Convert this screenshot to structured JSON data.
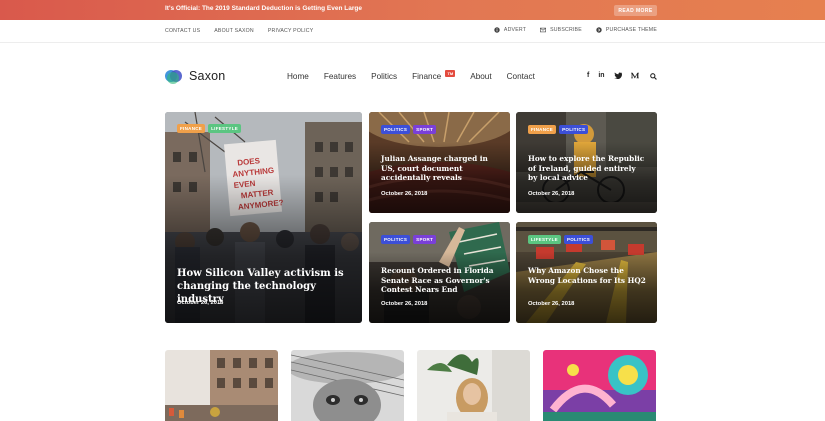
{
  "promo": {
    "text": "It's Official: The 2019 Standard Deduction is Getting Even Large",
    "button": "READ MORE"
  },
  "utility": {
    "links": [
      "CONTACT US",
      "ABOUT SAXON",
      "PRIVACY POLICY"
    ],
    "right": [
      {
        "label": "ADVERT",
        "icon": "info-icon"
      },
      {
        "label": "SUBSCRIBE",
        "icon": "mail-icon"
      },
      {
        "label": "PURCHASE THEME",
        "icon": "circle-arrow-icon"
      }
    ]
  },
  "header": {
    "logo": "Saxon",
    "nav": [
      "Home",
      "Features",
      "Politics",
      "Finance",
      "About",
      "Contact"
    ],
    "finance_badge": "TM",
    "social": [
      "f",
      "in",
      "twitter-icon",
      "medium-icon"
    ]
  },
  "colors": {
    "finance_tag": "#f0a04a",
    "lifestyle_tag": "#5bc581",
    "politics_tag": "#3c4fd8",
    "sport_tag": "#7a3fd8"
  },
  "cards": {
    "featured": {
      "tags": [
        "FINANCE",
        "LIFESTYLE"
      ],
      "title": "How Silicon Valley activism is changing the technology industry",
      "date": "October 26, 2018"
    },
    "top_middle": {
      "tags": [
        "POLITICS",
        "SPORT"
      ],
      "title": "Julian Assange charged in US, court document accidentally reveals",
      "date": "October 26, 2018"
    },
    "top_right": {
      "tags": [
        "FINANCE",
        "POLITICS"
      ],
      "title": "How to explore the Republic of Ireland, guided entirely by local advice",
      "date": "October 26, 2018"
    },
    "bottom_middle": {
      "tags": [
        "POLITICS",
        "SPORT"
      ],
      "title": "Recount Ordered in Florida Senate Race as Governor's Contest Nears End",
      "date": "October 26, 2018"
    },
    "bottom_right": {
      "tags": [
        "LIFESTYLE",
        "POLITICS"
      ],
      "title": "Why Amazon Chose the Wrong Locations for Its HQ2",
      "date": "October 26, 2018"
    }
  }
}
